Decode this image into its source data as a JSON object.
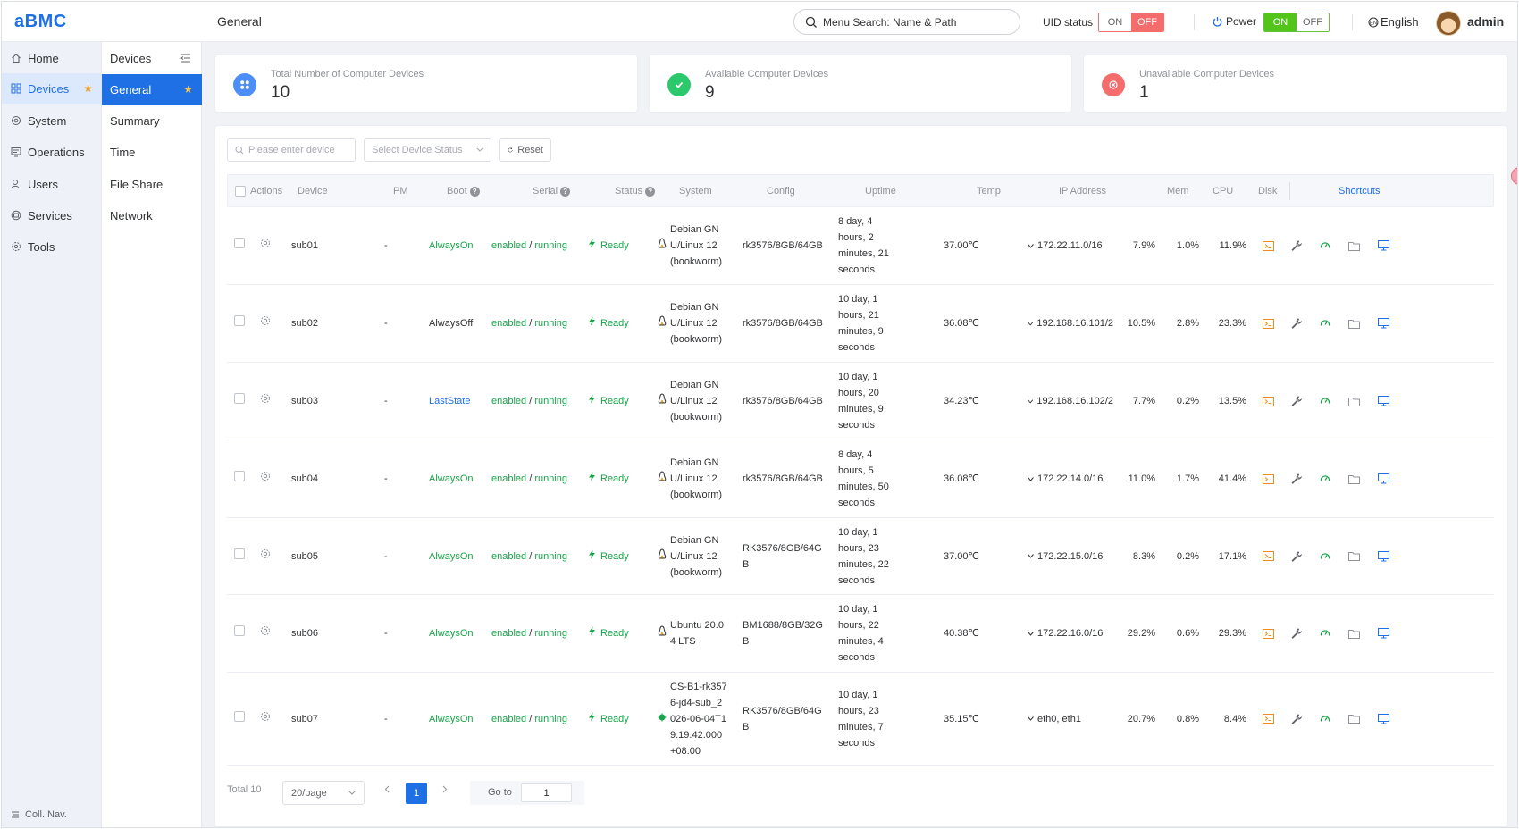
{
  "header": {
    "logo": "aBMC",
    "page_title": "General",
    "search_placeholder": "Menu Search: Name & Path",
    "uid_label": "UID status",
    "uid_on": "ON",
    "uid_off": "OFF",
    "power_label": "Power",
    "power_on": "ON",
    "power_off": "OFF",
    "language": "English",
    "user": "admin"
  },
  "nav_primary": {
    "items": [
      {
        "label": "Home",
        "icon": "home-icon"
      },
      {
        "label": "Devices",
        "icon": "devices-icon",
        "active": true,
        "starred": true
      },
      {
        "label": "System",
        "icon": "system-icon"
      },
      {
        "label": "Operations",
        "icon": "operations-icon"
      },
      {
        "label": "Users",
        "icon": "users-icon"
      },
      {
        "label": "Services",
        "icon": "services-icon"
      },
      {
        "label": "Tools",
        "icon": "tools-icon"
      }
    ],
    "collapse_label": "Coll. Nav."
  },
  "nav_secondary": {
    "title": "Devices",
    "items": [
      "General",
      "Summary",
      "Time",
      "File Share",
      "Network"
    ]
  },
  "stats": {
    "total": {
      "label": "Total Number of Computer Devices",
      "value": "10"
    },
    "available": {
      "label": "Available Computer Devices",
      "value": "9"
    },
    "unavailable": {
      "label": "Unavailable Computer Devices",
      "value": "1"
    }
  },
  "filters": {
    "device_placeholder": "Please enter device",
    "status_placeholder": "Select Device Status",
    "reset_label": "Reset"
  },
  "table": {
    "columns": {
      "actions": "Actions",
      "device": "Device",
      "pm": "PM",
      "boot": "Boot",
      "serial": "Serial",
      "status": "Status",
      "system": "System",
      "config": "Config",
      "uptime": "Uptime",
      "temp": "Temp",
      "ip": "IP Address",
      "mem": "Mem",
      "cpu": "CPU",
      "disk": "Disk",
      "shortcuts": "Shortcuts"
    },
    "rows": [
      {
        "device": "sub01",
        "pm": "-",
        "boot": "AlwaysOn",
        "serial_a": "enabled",
        "serial_b": "running",
        "status": "Ready",
        "system": [
          "Debian GN",
          "U/Linux 12",
          "(bookworm)"
        ],
        "config": [
          "rk3576/8GB/64GB"
        ],
        "uptime": [
          "8 day, 4",
          "hours, 2",
          "minutes, 21",
          "seconds"
        ],
        "temp": "37.00℃",
        "ip": "172.22.11.0/16",
        "mem": "7.9%",
        "cpu": "1.0%",
        "disk": "11.9%"
      },
      {
        "device": "sub02",
        "pm": "-",
        "boot": "AlwaysOff",
        "serial_a": "enabled",
        "serial_b": "running",
        "status": "Ready",
        "system": [
          "Debian GN",
          "U/Linux 12",
          "(bookworm)"
        ],
        "config": [
          "rk3576/8GB/64GB"
        ],
        "uptime": [
          "10 day, 1",
          "hours, 21",
          "minutes, 9",
          "seconds"
        ],
        "temp": "36.08℃",
        "ip": "192.168.16.101/2",
        "mem": "10.5%",
        "cpu": "2.8%",
        "disk": "23.3%"
      },
      {
        "device": "sub03",
        "pm": "-",
        "boot": "LastState",
        "serial_a": "enabled",
        "serial_b": "running",
        "status": "Ready",
        "system": [
          "Debian GN",
          "U/Linux 12",
          "(bookworm)"
        ],
        "config": [
          "rk3576/8GB/64GB"
        ],
        "uptime": [
          "10 day, 1",
          "hours, 20",
          "minutes, 9",
          "seconds"
        ],
        "temp": "34.23℃",
        "ip": "192.168.16.102/2",
        "mem": "7.7%",
        "cpu": "0.2%",
        "disk": "13.5%"
      },
      {
        "device": "sub04",
        "pm": "-",
        "boot": "AlwaysOn",
        "serial_a": "enabled",
        "serial_b": "running",
        "status": "Ready",
        "system": [
          "Debian GN",
          "U/Linux 12",
          "(bookworm)"
        ],
        "config": [
          "rk3576/8GB/64GB"
        ],
        "uptime": [
          "8 day, 4",
          "hours, 5",
          "minutes, 50",
          "seconds"
        ],
        "temp": "36.08℃",
        "ip": "172.22.14.0/16",
        "mem": "11.0%",
        "cpu": "1.7%",
        "disk": "41.4%"
      },
      {
        "device": "sub05",
        "pm": "-",
        "boot": "AlwaysOn",
        "serial_a": "enabled",
        "serial_b": "running",
        "status": "Ready",
        "system": [
          "Debian GN",
          "U/Linux 12",
          "(bookworm)"
        ],
        "config": [
          "RK3576/8GB/64G",
          "B"
        ],
        "uptime": [
          "10 day, 1",
          "hours, 23",
          "minutes, 22",
          "seconds"
        ],
        "temp": "37.00℃",
        "ip": "172.22.15.0/16",
        "mem": "8.3%",
        "cpu": "0.2%",
        "disk": "17.1%"
      },
      {
        "device": "sub06",
        "pm": "-",
        "boot": "AlwaysOn",
        "serial_a": "enabled",
        "serial_b": "running",
        "status": "Ready",
        "system": [
          "Ubuntu 20.0",
          "4 LTS"
        ],
        "config": [
          "BM1688/8GB/32G",
          "B"
        ],
        "uptime": [
          "10 day, 1",
          "hours, 22",
          "minutes, 4",
          "seconds"
        ],
        "temp": "40.38℃",
        "ip": "172.22.16.0/16",
        "mem": "29.2%",
        "cpu": "0.6%",
        "disk": "29.3%"
      },
      {
        "device": "sub07",
        "pm": "-",
        "boot": "AlwaysOn",
        "serial_a": "enabled",
        "serial_b": "running",
        "status": "Ready",
        "system": [
          "CS-B1-rk357",
          "6-jd4-sub_2",
          "026-06-04T1",
          "9:19:42.000",
          "+08:00"
        ],
        "config": [
          "RK3576/8GB/64G",
          "B"
        ],
        "uptime": [
          "10 day, 1",
          "hours, 23",
          "minutes, 7",
          "seconds"
        ],
        "temp": "35.15℃",
        "ip": "eth0, eth1",
        "mem": "20.7%",
        "cpu": "0.8%",
        "disk": "8.4%"
      }
    ]
  },
  "pagination": {
    "total": "Total 10",
    "page_size": "20/page",
    "current": "1",
    "goto_label": "Go to",
    "goto_value": "1"
  }
}
